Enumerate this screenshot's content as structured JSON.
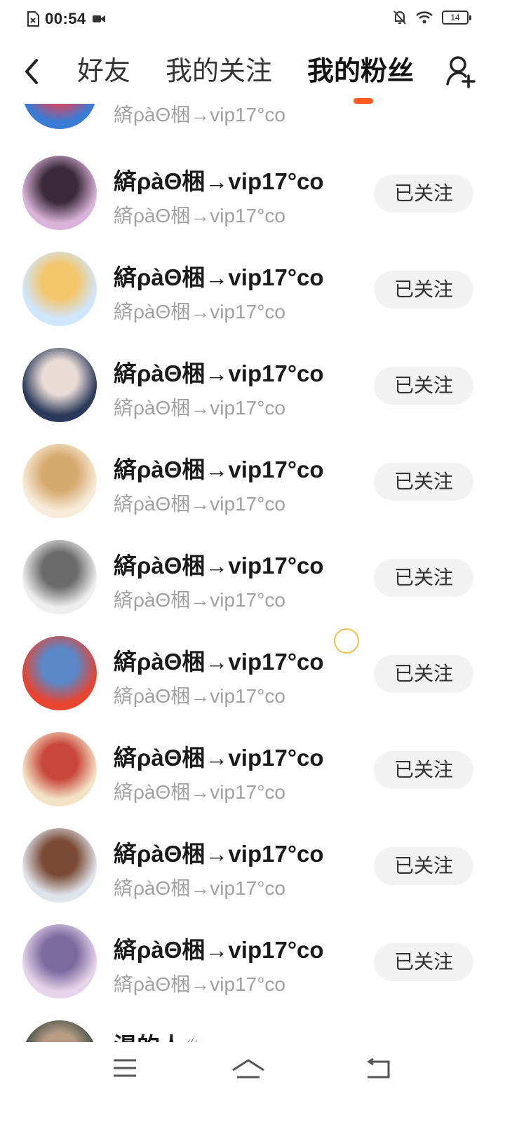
{
  "status_bar": {
    "time": "00:54",
    "battery": "14"
  },
  "header": {
    "tabs": [
      {
        "label": "好友"
      },
      {
        "label": "我的关注"
      },
      {
        "label": "我的粉丝",
        "active": true
      }
    ],
    "accent_color": "#ff5a1f"
  },
  "list": {
    "items": [
      {
        "name": "",
        "sub": "緕ρàΘ梱→vip17°co",
        "button": "已关注",
        "avatar_colors": [
          "#3a7bd5",
          "#e0445a"
        ]
      },
      {
        "name": "緕ρàΘ梱→vip17°co",
        "sub": "緕ρàΘ梱→vip17°co",
        "button": "已关注",
        "avatar_colors": [
          "#d9b3d9",
          "#3b2a3a"
        ]
      },
      {
        "name": "緕ρàΘ梱→vip17°co",
        "sub": "緕ρàΘ梱→vip17°co",
        "button": "已关注",
        "avatar_colors": [
          "#cfe6ff",
          "#f3c66a"
        ]
      },
      {
        "name": "緕ρàΘ梱→vip17°co",
        "sub": "緕ρàΘ梱→vip17°co",
        "button": "已关注",
        "avatar_colors": [
          "#2c3a5a",
          "#e9dcd6"
        ]
      },
      {
        "name": "緕ρàΘ梱→vip17°co",
        "sub": "緕ρàΘ梱→vip17°co",
        "button": "已关注",
        "avatar_colors": [
          "#f7ecd9",
          "#d6a96e"
        ]
      },
      {
        "name": "緕ρàΘ梱→vip17°co",
        "sub": "緕ρàΘ梱→vip17°co",
        "button": "已关注",
        "avatar_colors": [
          "#eeeeee",
          "#6b6b6b"
        ]
      },
      {
        "name": "緕ρàΘ梱→vip17°co",
        "sub": "緕ρàΘ梱→vip17°co",
        "button": "已关注",
        "avatar_colors": [
          "#e8442f",
          "#5a88c8"
        ]
      },
      {
        "name": "緕ρàΘ梱→vip17°co",
        "sub": "緕ρàΘ梱→vip17°co",
        "button": "已关注",
        "avatar_colors": [
          "#f3e3c6",
          "#c8463a"
        ]
      },
      {
        "name": "緕ρàΘ梱→vip17°co",
        "sub": "緕ρàΘ梱→vip17°co",
        "button": "已关注",
        "avatar_colors": [
          "#dfe3ea",
          "#7a4a36"
        ]
      },
      {
        "name": "緕ρàΘ梱→vip17°co",
        "sub": "緕ρàΘ梱→vip17°co",
        "button": "已关注",
        "avatar_colors": [
          "#e6d4ea",
          "#7b6a9e"
        ]
      },
      {
        "name": "渴的人♨",
        "sub": "",
        "button": "",
        "avatar_colors": [
          "#3a4a44",
          "#b89c84"
        ]
      }
    ]
  },
  "nav": {
    "icons": [
      "menu-icon",
      "home-icon",
      "back-nav-icon"
    ]
  }
}
